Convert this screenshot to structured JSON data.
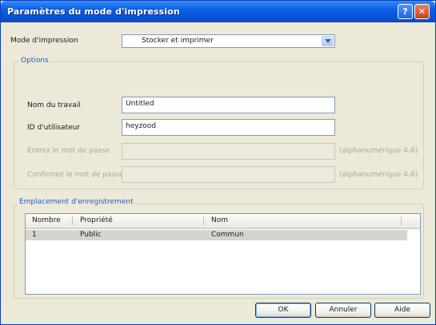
{
  "window": {
    "title": "Paramètres du mode d'impression",
    "help_glyph": "?",
    "close_glyph": "✕"
  },
  "print_mode": {
    "label": "Mode d'impression",
    "value": "Stocker et imprimer"
  },
  "options": {
    "group_title": "Options",
    "job_name": {
      "label": "Nom du travail",
      "value": "Untitled"
    },
    "user_id": {
      "label": "ID d'utilisateur",
      "value": "heyzood"
    },
    "password": {
      "label": "Entrez le mot de passe",
      "value": "",
      "hint": "(alphanumérique 4-8)"
    },
    "confirm_password": {
      "label": "Confirmez le mot de passe",
      "value": "",
      "hint": "(alphanumérique 4-8)"
    }
  },
  "storage": {
    "group_title": "Emplacement d'enregistrement",
    "columns": [
      "Nombre",
      "Propriété",
      "Nom"
    ],
    "rows": [
      {
        "number": "1",
        "property": "Public",
        "name": "Commun"
      }
    ]
  },
  "buttons": {
    "ok": "OK",
    "cancel": "Annuler",
    "help": "Aide"
  }
}
